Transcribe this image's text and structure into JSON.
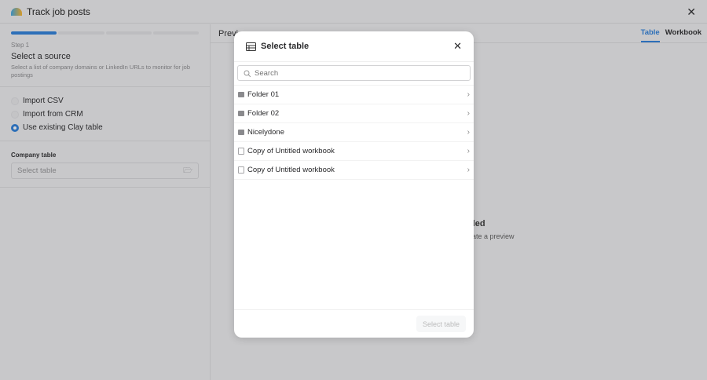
{
  "header": {
    "title": "Track job posts"
  },
  "sidebar": {
    "step": "Step 1",
    "heading": "Select a source",
    "description": "Select a list of company domains or LinkedIn URLs to monitor for job postings",
    "progress_steps": 4,
    "progress_current": 1,
    "options": [
      {
        "label": "Import CSV",
        "selected": false
      },
      {
        "label": "Import from CRM",
        "selected": false
      },
      {
        "label": "Use existing Clay table",
        "selected": true
      }
    ],
    "field_label": "Company table",
    "field_placeholder": "Select table"
  },
  "preview": {
    "title_fragment": "Previ",
    "tabs": [
      {
        "label": "Table",
        "active": true
      },
      {
        "label": "Workbook",
        "active": false
      }
    ],
    "empty_title_fragment": "ded",
    "empty_sub_fragment": "rate a preview"
  },
  "modal": {
    "title": "Select table",
    "search_placeholder": "Search",
    "items": [
      {
        "label": "Folder 01",
        "type": "folder"
      },
      {
        "label": "Folder 02",
        "type": "folder"
      },
      {
        "label": "Nicelydone",
        "type": "folder"
      },
      {
        "label": "Copy of Untitled workbook",
        "type": "workbook"
      },
      {
        "label": "Copy of Untitled workbook",
        "type": "workbook"
      }
    ],
    "confirm_label": "Select table"
  },
  "colors": {
    "accent": "#2d6fb8"
  }
}
